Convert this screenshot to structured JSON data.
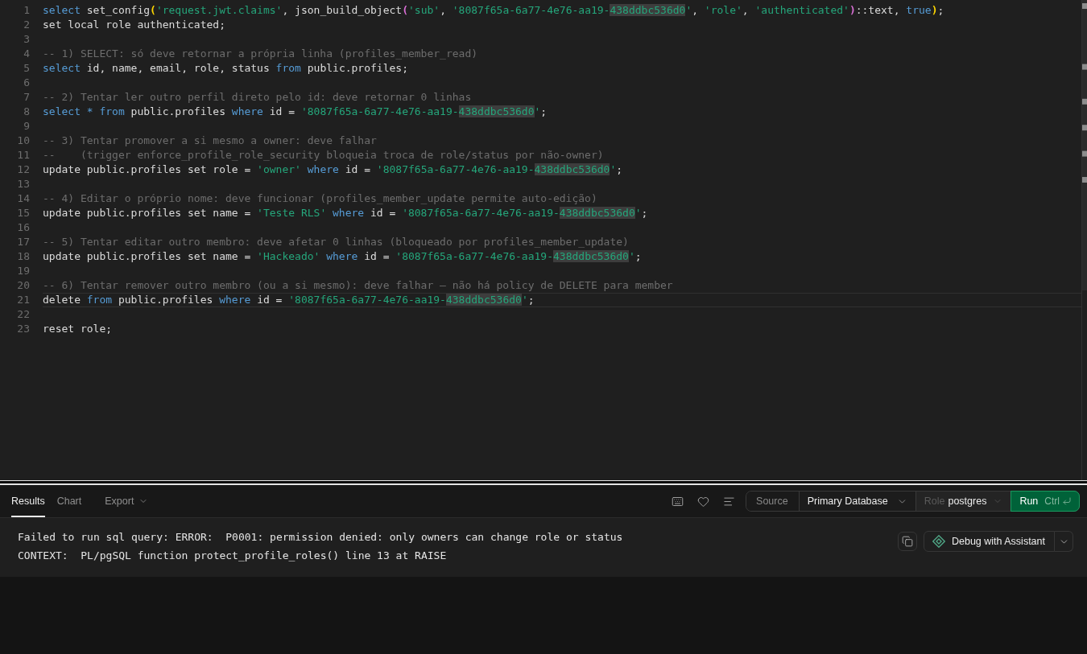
{
  "editor": {
    "lines": [
      {
        "number": "1",
        "current": false,
        "tokens": [
          {
            "kind": "keyword",
            "text": "select"
          },
          {
            "kind": "text",
            "text": " set_config"
          },
          {
            "kind": "bracket",
            "text": "(",
            "color": "#ffd700"
          },
          {
            "kind": "string",
            "text": "'request.jwt.claims'"
          },
          {
            "kind": "text",
            "text": ", json_build_object"
          },
          {
            "kind": "bracket",
            "text": "(",
            "color": "#da70d6"
          },
          {
            "kind": "string",
            "text": "'sub'"
          },
          {
            "kind": "text",
            "text": ", "
          },
          {
            "kind": "string",
            "text": "'8087f65a-6a77-4e76-aa19-"
          },
          {
            "kind": "match",
            "text": "438ddbc536d0"
          },
          {
            "kind": "string",
            "text": "'"
          },
          {
            "kind": "text",
            "text": ", "
          },
          {
            "kind": "string",
            "text": "'role'"
          },
          {
            "kind": "text",
            "text": ", "
          },
          {
            "kind": "string",
            "text": "'authenticated'"
          },
          {
            "kind": "bracket",
            "text": ")",
            "color": "#da70d6"
          },
          {
            "kind": "text",
            "text": "::text, "
          },
          {
            "kind": "keyword",
            "text": "true"
          },
          {
            "kind": "bracket",
            "text": ")",
            "color": "#ffd700"
          },
          {
            "kind": "text",
            "text": ";"
          }
        ]
      },
      {
        "number": "2",
        "current": false,
        "tokens": [
          {
            "kind": "text",
            "text": "set local role authenticated;"
          }
        ]
      },
      {
        "number": "3",
        "current": false
      },
      {
        "number": "4",
        "current": false,
        "tokens": [
          {
            "kind": "comment",
            "text": "-- 1) SELECT: só deve retornar a própria linha (profiles_member_read)"
          }
        ]
      },
      {
        "number": "5",
        "current": false,
        "tokens": [
          {
            "kind": "keyword",
            "text": "select"
          },
          {
            "kind": "text",
            "text": " id, name, email, role, status "
          },
          {
            "kind": "keyword",
            "text": "from"
          },
          {
            "kind": "text",
            "text": " public.profiles;"
          }
        ]
      },
      {
        "number": "6",
        "current": false
      },
      {
        "number": "7",
        "current": false,
        "tokens": [
          {
            "kind": "comment",
            "text": "-- 2) Tentar ler outro perfil direto pelo id: deve retornar 0 linhas"
          }
        ]
      },
      {
        "number": "8",
        "current": false,
        "tokens": [
          {
            "kind": "keyword",
            "text": "select * from"
          },
          {
            "kind": "text",
            "text": " public.profiles "
          },
          {
            "kind": "keyword",
            "text": "where"
          },
          {
            "kind": "text",
            "text": " id = "
          },
          {
            "kind": "string",
            "text": "'8087f65a-6a77-4e76-aa19-"
          },
          {
            "kind": "match",
            "text": "438ddbc536d0"
          },
          {
            "kind": "string",
            "text": "'"
          },
          {
            "kind": "text",
            "text": ";"
          }
        ]
      },
      {
        "number": "9",
        "current": false
      },
      {
        "number": "10",
        "current": false,
        "tokens": [
          {
            "kind": "comment",
            "text": "-- 3) Tentar promover a si mesmo a owner: deve falhar"
          }
        ]
      },
      {
        "number": "11",
        "current": false,
        "tokens": [
          {
            "kind": "comment",
            "text": "--    (trigger enforce_profile_role_security bloqueia troca de role/status por não-owner)"
          }
        ]
      },
      {
        "number": "12",
        "current": false,
        "tokens": [
          {
            "kind": "text",
            "text": "update public.profiles set role = "
          },
          {
            "kind": "string",
            "text": "'owner'"
          },
          {
            "kind": "keyword",
            "text": " where"
          },
          {
            "kind": "text",
            "text": " id = "
          },
          {
            "kind": "string",
            "text": "'8087f65a-6a77-4e76-aa19-"
          },
          {
            "kind": "match",
            "text": "438ddbc536d0"
          },
          {
            "kind": "string",
            "text": "'"
          },
          {
            "kind": "text",
            "text": ";"
          }
        ]
      },
      {
        "number": "13",
        "current": false
      },
      {
        "number": "14",
        "current": false,
        "tokens": [
          {
            "kind": "comment",
            "text": "-- 4) Editar o próprio nome: deve funcionar (profiles_member_update permite auto-edição)"
          }
        ]
      },
      {
        "number": "15",
        "current": false,
        "tokens": [
          {
            "kind": "text",
            "text": "update public.profiles set name = "
          },
          {
            "kind": "string",
            "text": "'Teste RLS'"
          },
          {
            "kind": "keyword",
            "text": " where"
          },
          {
            "kind": "text",
            "text": " id = "
          },
          {
            "kind": "string",
            "text": "'8087f65a-6a77-4e76-aa19-"
          },
          {
            "kind": "match",
            "text": "438ddbc536d0"
          },
          {
            "kind": "string",
            "text": "'"
          },
          {
            "kind": "text",
            "text": ";"
          }
        ]
      },
      {
        "number": "16",
        "current": false
      },
      {
        "number": "17",
        "current": false,
        "tokens": [
          {
            "kind": "comment",
            "text": "-- 5) Tentar editar outro membro: deve afetar 0 linhas (bloqueado por profiles_member_update)"
          }
        ]
      },
      {
        "number": "18",
        "current": false,
        "tokens": [
          {
            "kind": "text",
            "text": "update public.profiles set name = "
          },
          {
            "kind": "string",
            "text": "'Hackeado'"
          },
          {
            "kind": "keyword",
            "text": " where"
          },
          {
            "kind": "text",
            "text": " id = "
          },
          {
            "kind": "string",
            "text": "'8087f65a-6a77-4e76-aa19-"
          },
          {
            "kind": "match",
            "text": "438ddbc536d0"
          },
          {
            "kind": "string",
            "text": "'"
          },
          {
            "kind": "text",
            "text": ";"
          }
        ]
      },
      {
        "number": "19",
        "current": false
      },
      {
        "number": "20",
        "current": false,
        "tokens": [
          {
            "kind": "comment",
            "text": "-- 6) Tentar remover outro membro (ou a si mesmo): deve falhar — não há policy de DELETE para member"
          }
        ]
      },
      {
        "number": "21",
        "current": true,
        "tokens": [
          {
            "kind": "text",
            "text": "delete "
          },
          {
            "kind": "keyword",
            "text": "from"
          },
          {
            "kind": "text",
            "text": " public.profiles "
          },
          {
            "kind": "keyword",
            "text": "where"
          },
          {
            "kind": "text",
            "text": " id = "
          },
          {
            "kind": "string",
            "text": "'8087f65a-6a77-4e76-aa19-"
          },
          {
            "kind": "match",
            "text": "438ddbc536d0"
          },
          {
            "kind": "string",
            "text": "'"
          },
          {
            "kind": "text",
            "text": ";"
          }
        ]
      },
      {
        "number": "22",
        "current": false
      },
      {
        "number": "23",
        "current": false,
        "tokens": [
          {
            "kind": "text",
            "text": "reset role;"
          }
        ]
      }
    ]
  },
  "results_toolbar": {
    "tabs": [
      {
        "label": "Results",
        "selected": true
      },
      {
        "label": "Chart",
        "selected": false
      }
    ],
    "export_menu": {
      "label": "Export"
    },
    "source": {
      "label": "Source"
    },
    "database": {
      "value": "Primary Database"
    },
    "role": {
      "label": "Role",
      "value": "postgres"
    },
    "run_button": {
      "label": "Run",
      "shortcut": "Ctrl"
    }
  },
  "results": {
    "error_lines": [
      "Failed to run sql query: ERROR:  P0001: permission denied: only owners can change role or status",
      "CONTEXT:  PL/pgSQL function protect_profile_roles() line 13 at RAISE"
    ],
    "debug_button": {
      "label": "Debug with Assistant"
    }
  }
}
